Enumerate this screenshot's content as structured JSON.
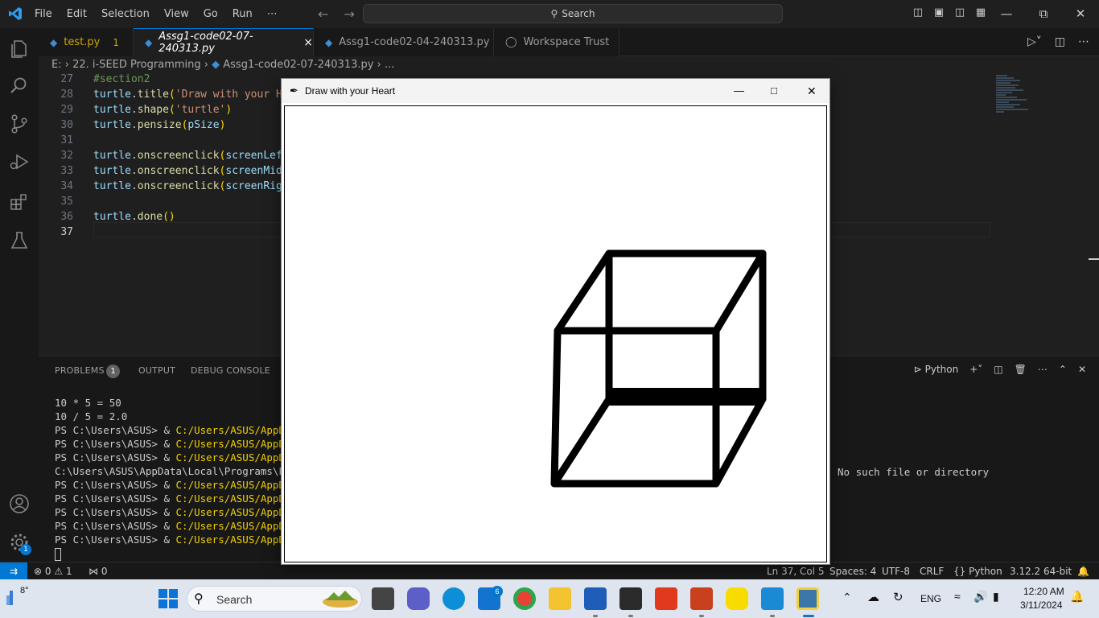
{
  "titlebar": {
    "menu": [
      "File",
      "Edit",
      "Selection",
      "View",
      "Go",
      "Run",
      "⋯"
    ],
    "search_placeholder": "Search"
  },
  "tabs": [
    {
      "label": "test.py",
      "badge": "1"
    },
    {
      "label": "Assg1-code02-07-240313.py",
      "close": "×"
    },
    {
      "label": "Assg1-code02-04-240313.py"
    },
    {
      "label": "Workspace Trust"
    }
  ],
  "breadcrumbs": {
    "drive": "E:",
    "folder": "22. i-SEED Programming",
    "file": "Assg1-code02-07-240313.py",
    "more": "..."
  },
  "editor": {
    "lines": [
      {
        "n": "27",
        "parts": [
          [
            "#section2",
            "cm"
          ]
        ]
      },
      {
        "n": "28",
        "parts": [
          [
            "turtle",
            "var"
          ],
          [
            ".",
            "pl"
          ],
          [
            "title",
            "fn"
          ],
          [
            "(",
            "pn"
          ],
          [
            "'Draw with your He",
            "str"
          ]
        ]
      },
      {
        "n": "29",
        "parts": [
          [
            "turtle",
            "var"
          ],
          [
            ".",
            "pl"
          ],
          [
            "shape",
            "fn"
          ],
          [
            "(",
            "pn"
          ],
          [
            "'turtle'",
            "str"
          ],
          [
            ")",
            "pn"
          ]
        ]
      },
      {
        "n": "30",
        "parts": [
          [
            "turtle",
            "var"
          ],
          [
            ".",
            "pl"
          ],
          [
            "pensize",
            "fn"
          ],
          [
            "(",
            "pn"
          ],
          [
            "pSize",
            "var"
          ],
          [
            ")",
            "pn"
          ]
        ]
      },
      {
        "n": "31",
        "parts": []
      },
      {
        "n": "32",
        "parts": [
          [
            "turtle",
            "var"
          ],
          [
            ".",
            "pl"
          ],
          [
            "onscreenclick",
            "fn"
          ],
          [
            "(",
            "pn"
          ],
          [
            "screenLef",
            "var"
          ]
        ]
      },
      {
        "n": "33",
        "parts": [
          [
            "turtle",
            "var"
          ],
          [
            ".",
            "pl"
          ],
          [
            "onscreenclick",
            "fn"
          ],
          [
            "(",
            "pn"
          ],
          [
            "screenMid",
            "var"
          ]
        ]
      },
      {
        "n": "34",
        "parts": [
          [
            "turtle",
            "var"
          ],
          [
            ".",
            "pl"
          ],
          [
            "onscreenclick",
            "fn"
          ],
          [
            "(",
            "pn"
          ],
          [
            "screenRig",
            "var"
          ]
        ]
      },
      {
        "n": "35",
        "parts": []
      },
      {
        "n": "36",
        "parts": [
          [
            "turtle",
            "var"
          ],
          [
            ".",
            "pl"
          ],
          [
            "done",
            "fn"
          ],
          [
            "()",
            "pn"
          ]
        ]
      },
      {
        "n": "37",
        "parts": []
      }
    ]
  },
  "panel": {
    "tabs": [
      "PROBLEMS",
      "OUTPUT",
      "DEBUG CONSOLE"
    ],
    "problems_count": "1",
    "terminal_name": "Python",
    "terminal_lines": [
      {
        "pre": "10 * 5 = 50",
        "path": ""
      },
      {
        "pre": "10 / 5 = 2.0",
        "path": ""
      },
      {
        "pre": "PS C:\\Users\\ASUS> & ",
        "path": "C:/Users/ASUS/AppDat"
      },
      {
        "pre": "PS C:\\Users\\ASUS> & ",
        "path": "C:/Users/ASUS/AppDat"
      },
      {
        "pre": "PS C:\\Users\\ASUS> & ",
        "path": "C:/Users/ASUS/AppDat"
      },
      {
        "pre": "C:\\Users\\ASUS\\AppData\\Local\\Programs\\Pyt",
        "path": ""
      },
      {
        "pre": "PS C:\\Users\\ASUS> & ",
        "path": "C:/Users/ASUS/AppDat"
      },
      {
        "pre": "PS C:\\Users\\ASUS> & ",
        "path": "C:/Users/ASUS/AppDat"
      },
      {
        "pre": "PS C:\\Users\\ASUS> & ",
        "path": "C:/Users/ASUS/AppDat"
      },
      {
        "pre": "PS C:\\Users\\ASUS> & ",
        "path": "C:/Users/ASUS/AppDat"
      },
      {
        "pre": "PS C:\\Users\\ASUS> & ",
        "path": "C:/Users/ASUS/AppDat"
      }
    ],
    "error_tail": "No such file or directory"
  },
  "statusbar": {
    "errors": "0",
    "warnings": "1",
    "ports": "0",
    "position": "Ln 37, Col 5",
    "spaces": "Spaces: 4",
    "encoding": "UTF-8",
    "eol": "CRLF",
    "language": "Python",
    "interpreter": "3.12.2 64-bit"
  },
  "turtle_window": {
    "title": "Draw with your Heart"
  },
  "taskbar": {
    "weather": "8°",
    "search_label": "Search",
    "mail_badge": "6",
    "lang": "ENG",
    "time": "12:20 AM",
    "date": "3/11/2024"
  },
  "colors": {
    "accent": "#0078d4",
    "editor_bg": "#1f1f1f",
    "terminal_path": "#f1d000"
  }
}
